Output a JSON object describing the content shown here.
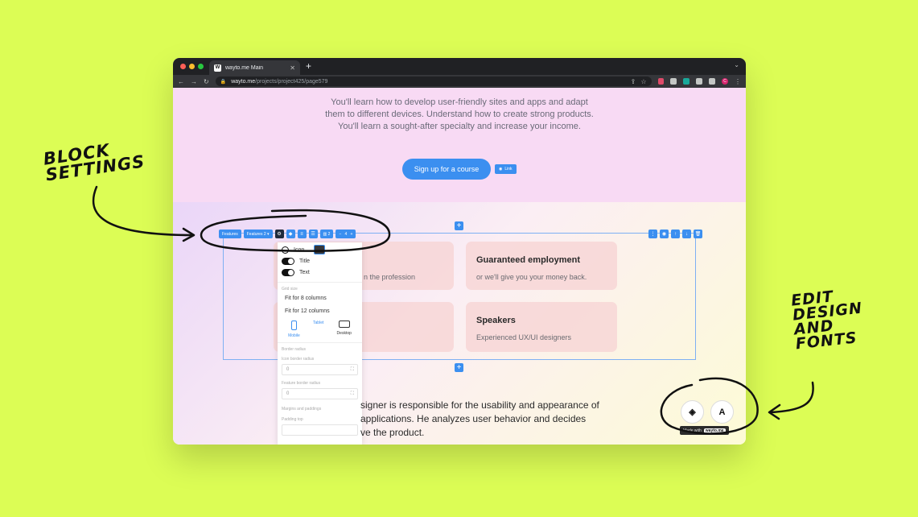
{
  "annotations": {
    "block_settings": [
      "BLOCK",
      "SETTINGS"
    ],
    "edit_design": [
      "EDIT",
      "DESIGN",
      "AND",
      "FONTS"
    ]
  },
  "browser": {
    "tab_title": "wayto.me Main",
    "url_domain": "wayto.me",
    "url_path": "/projects/project425/page579",
    "profile_initial": "C"
  },
  "hero": {
    "text": "You'll learn how to develop user-friendly sites and apps and adapt them to different devices. Understand how to create strong products. You'll learn a sought-after specialty and increase your income.",
    "cta_label": "Sign up for a course",
    "link_chip": "Link"
  },
  "toolbar": {
    "block_name": "Features",
    "variant": "Features 2",
    "columns": "2",
    "minus": "−",
    "count": "4",
    "plus": "+"
  },
  "cards": [
    {
      "title": "",
      "text": "n the profession"
    },
    {
      "title": "Guaranteed employment",
      "text": "or we'll give you your money back."
    },
    {
      "title": "",
      "text": ""
    },
    {
      "title": "Speakers",
      "text": "Experienced UX/UI designers"
    }
  ],
  "panel": {
    "toggles": [
      {
        "label": "Icon",
        "on": false
      },
      {
        "label": "Title",
        "on": true
      },
      {
        "label": "Text",
        "on": true
      }
    ],
    "grid_size_label": "Grid size",
    "grid_options": [
      "Fit for 8 columns",
      "Fit for 12 columns"
    ],
    "devices": [
      "Mobile",
      "Tablet",
      "Desktop"
    ],
    "border_radius_label": "Border radius",
    "icon_radius_label": "Icon border radius",
    "icon_radius_value": "0",
    "feature_radius_label": "Feature border radius",
    "feature_radius_value": "0",
    "margins_label": "Margins and paddings",
    "padding_top_label": "Padding top"
  },
  "about": {
    "lines": [
      "signer is responsible for the usability and appearance of",
      " applications. He analyzes user behavior and decides",
      "ve the product."
    ]
  },
  "footer": {
    "design_button": "",
    "font_button": "A",
    "made_with": "Made with",
    "brand": "wayto.me"
  },
  "colors": {
    "background": "#dcfd55",
    "accent": "#3b8ff0"
  }
}
